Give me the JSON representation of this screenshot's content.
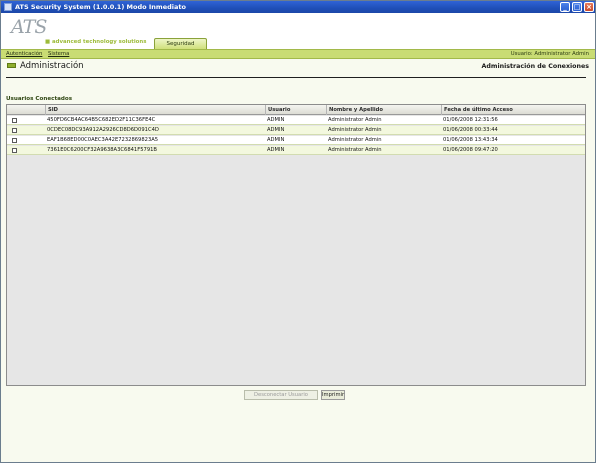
{
  "window": {
    "title": "ATS Security System (1.0.0.1) Modo Inmediato",
    "controls": [
      "_",
      "□",
      "×"
    ]
  },
  "brand": {
    "logo": "ATS",
    "tagline": "■ advanced technology solutions",
    "active_tab": "Seguridad"
  },
  "menu": {
    "items": [
      "Autenticación",
      "Sistema"
    ],
    "user": "Usuario: Administrator Admin"
  },
  "section": {
    "title": "Administración",
    "subtitle": "Administración de Conexiones"
  },
  "grid": {
    "group_label": "Usuarios Conectados",
    "columns": [
      "SID",
      "Usuario",
      "Nombre y Apellido",
      "Fecha de último Acceso"
    ],
    "rows": [
      {
        "sid": "450FD6CB4AC64B5C682ED2F11C36FE4C",
        "usuario": "ADMIN",
        "nombre": "Administrator Admin",
        "fecha": "01/06/2008 12:31:56"
      },
      {
        "sid": "0CDEC08DC93A912A2926CD8D6D091C4D",
        "usuario": "ADMIN",
        "nombre": "Administrator Admin",
        "fecha": "01/06/2008 00:33:44"
      },
      {
        "sid": "EAF1B68ED00C0AEC3A42E7232869823A5",
        "usuario": "ADMIN",
        "nombre": "Administrator Admin",
        "fecha": "01/06/2008 13:43:34"
      },
      {
        "sid": "7361E0C6200CF32A9638A3C6841F5791B",
        "usuario": "ADMIN",
        "nombre": "Administrator Admin",
        "fecha": "01/06/2008 09:47:20"
      }
    ]
  },
  "actions": {
    "disconnect": "Desconectar Usuario",
    "print": "Imprimir"
  },
  "colors": {
    "accent": "#c9dc74",
    "titlebar": "#1f4fb8",
    "row_alt": "#f3f8de"
  }
}
